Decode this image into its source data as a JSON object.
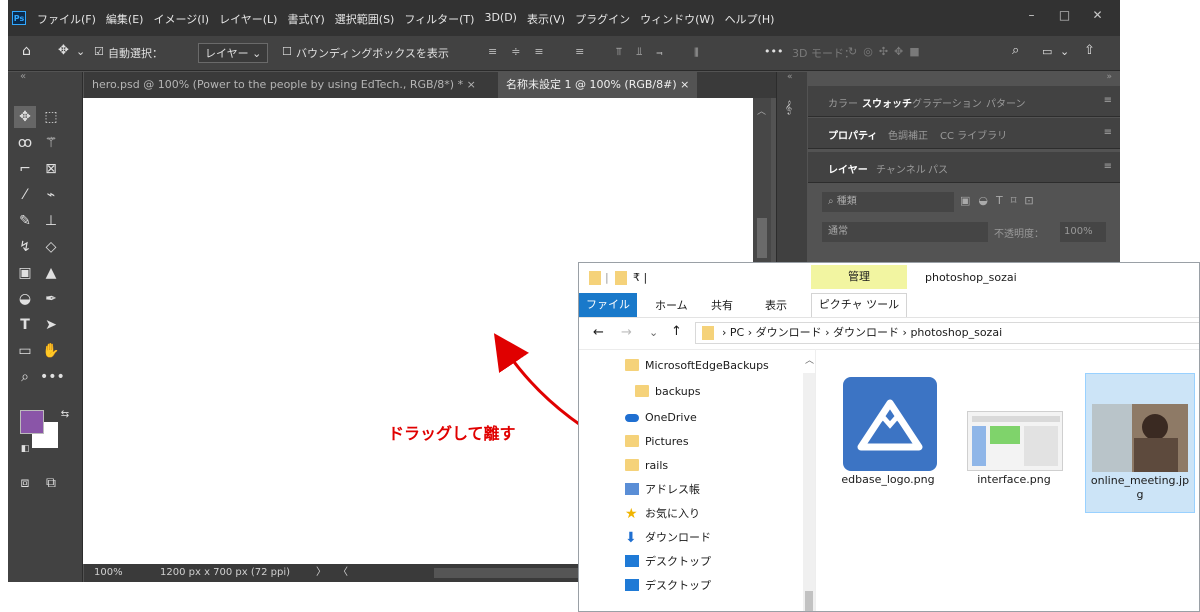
{
  "photoshop": {
    "logo": "Ps",
    "menu": [
      "ファイル(F)",
      "編集(E)",
      "イメージ(I)",
      "レイヤー(L)",
      "書式(Y)",
      "選択範囲(S)",
      "フィルター(T)",
      "3D(D)",
      "表示(V)",
      "プラグイン",
      "ウィンドウ(W)",
      "ヘルプ(H)"
    ],
    "window_controls": [
      "–",
      "□",
      "✕"
    ],
    "options_bar": {
      "auto_select_label": "自動選択：",
      "auto_select_target": "レイヤー",
      "bounding_box_label": "バウンディングボックスを表示",
      "mode_3d_label": "3D モード："
    },
    "tabs": [
      {
        "label": "hero.psd @ 100% (Power to the people by using EdTech., RGB/8*) *",
        "close": "×"
      },
      {
        "label": "名称未設定 1 @ 100% (RGB/8#)",
        "close": "×"
      }
    ],
    "status": {
      "zoom": "100%",
      "doc_size": "1200 px x 700 px (72 ppi)"
    },
    "colors": {
      "foreground": "#8a55a8",
      "background": "#ffffff"
    },
    "panels": {
      "swatch_tabs": [
        "カラー",
        "スウォッチ",
        "グラデーション",
        "パターン"
      ],
      "property_tabs": [
        "プロパティ",
        "色調補正",
        "CC ライブラリ"
      ],
      "layer_tabs": [
        "レイヤー",
        "チャンネル",
        "パス"
      ],
      "search_placeholder": "種類",
      "blend_mode": "通常",
      "opacity_label": "不透明度：",
      "opacity_value": "100%"
    }
  },
  "explorer": {
    "ribbon_contextual": "管理",
    "window_title": "photoshop_sozai",
    "ribbon_tabs": [
      "ファイル",
      "ホーム",
      "共有",
      "表示"
    ],
    "picture_tools": "ピクチャ ツール",
    "breadcrumb": [
      "PC",
      "ダウンロード",
      "ダウンロード",
      "photoshop_sozai"
    ],
    "tree": [
      "MicrosoftEdgeBackups",
      "backups",
      "OneDrive",
      "Pictures",
      "rails",
      "アドレス帳",
      "お気に入り",
      "ダウンロード",
      "デスクトップ",
      "デスクトップ"
    ],
    "files": [
      {
        "name": "edbase_logo.png"
      },
      {
        "name": "interface.png"
      },
      {
        "name": "online_meeting.jpg"
      }
    ]
  },
  "annotation": {
    "text": "ドラッグして離す",
    "color": "#e00000"
  }
}
